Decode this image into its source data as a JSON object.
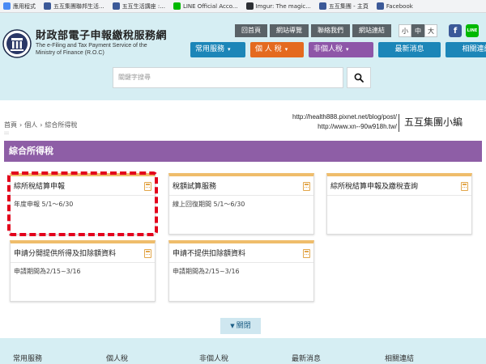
{
  "bookmarks": [
    {
      "label": "應用程式",
      "color": "#4a8af4"
    },
    {
      "label": "五互集團聯邦生活...",
      "color": "#3b5998"
    },
    {
      "label": "五互生活講座 :...",
      "color": "#3b5998"
    },
    {
      "label": "LINE Official Acco...",
      "color": "#00b900"
    },
    {
      "label": "Imgur: The magic...",
      "color": "#2c2f34"
    },
    {
      "label": "五互集團 - 主頁",
      "color": "#3b5998"
    },
    {
      "label": "Facebook",
      "color": "#3b5998"
    }
  ],
  "header": {
    "title": "財政部電子申報繳稅服務網",
    "subtitle_line1": "The e-Filing and Tax Payment Service of the",
    "subtitle_line2": "Ministry of Finance (R.O.C)",
    "toplinks": [
      "回首頁",
      "網站導覽",
      "聯絡我們",
      "網站連結"
    ],
    "fontsizes": [
      "小",
      "中",
      "大"
    ],
    "social_fb": "f",
    "social_line": "LINE",
    "menu": [
      {
        "label": "常用服務",
        "caret": "▾"
      },
      {
        "label": "個 人 稅",
        "caret": "▾"
      },
      {
        "label": "非個人稅",
        "caret": "▾"
      },
      {
        "label": "最新消息",
        "caret": ""
      },
      {
        "label": "相關連結",
        "caret": ""
      }
    ],
    "search_placeholder": "關鍵字搜尋"
  },
  "breadcrumb": [
    "首頁",
    "個人",
    "綜合所得稅"
  ],
  "breadcrumb_sep": "›",
  "dots": ":::",
  "watermark": {
    "url1": "http://health888.pixnet.net/blog/post/",
    "url2": "http://www.xn--90w918h.tw/",
    "name": "五互集團小編"
  },
  "page_title": "綜合所得稅",
  "cards": [
    {
      "title": "綜所稅結算申報",
      "body": "年度申報 5/1～6/30"
    },
    {
      "title": "稅額試算服務",
      "body": "線上回復期間 5/1～6/30"
    },
    {
      "title": "綜所稅結算申報及繳稅查詢",
      "body": ""
    },
    {
      "title": "申請分開提供所得及扣除額資料",
      "body": "申請期間為2/15~3/16"
    },
    {
      "title": "申請不提供扣除額資料",
      "body": "申請期間為2/15~3/16"
    }
  ],
  "toggle": {
    "arrow": "▼",
    "label": "關閉"
  },
  "footer": [
    "常用服務",
    "個人稅",
    "非個人稅",
    "最新消息",
    "相關連結"
  ]
}
